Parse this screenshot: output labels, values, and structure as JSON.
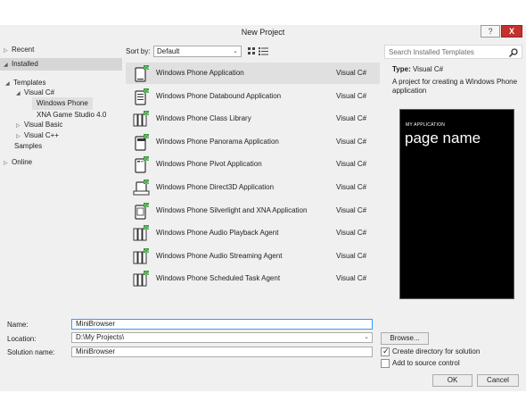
{
  "window": {
    "title": "New Project",
    "help_label": "?",
    "close_label": "X"
  },
  "tree": {
    "recent": "Recent",
    "installed": "Installed",
    "templates": "Templates",
    "visual_csharp": "Visual C#",
    "windows_phone": "Windows Phone",
    "xna": "XNA Game Studio 4.0",
    "visual_basic": "Visual Basic",
    "visual_cpp": "Visual C++",
    "samples": "Samples",
    "online": "Online"
  },
  "sort": {
    "label": "Sort by:",
    "value": "Default"
  },
  "templates": [
    {
      "name": "Windows Phone Application",
      "lang": "Visual C#",
      "selected": true
    },
    {
      "name": "Windows Phone Databound Application",
      "lang": "Visual C#"
    },
    {
      "name": "Windows Phone Class Library",
      "lang": "Visual C#"
    },
    {
      "name": "Windows Phone Panorama Application",
      "lang": "Visual C#"
    },
    {
      "name": "Windows Phone Pivot Application",
      "lang": "Visual C#"
    },
    {
      "name": "Windows Phone Direct3D Application",
      "lang": "Visual C#"
    },
    {
      "name": "Windows Phone Silverlight and XNA Application",
      "lang": "Visual C#"
    },
    {
      "name": "Windows Phone Audio Playback Agent",
      "lang": "Visual C#"
    },
    {
      "name": "Windows Phone Audio Streaming Agent",
      "lang": "Visual C#"
    },
    {
      "name": "Windows Phone Scheduled Task Agent",
      "lang": "Visual C#"
    }
  ],
  "details": {
    "search_placeholder": "Search Installed Templates",
    "type_label": "Type:",
    "type_value": "Visual C#",
    "description": "A project for creating a Windows Phone application",
    "preview_app": "MY APPLICATION",
    "preview_page": "page name"
  },
  "form": {
    "name_label": "Name:",
    "name_value": "MiniBrowser",
    "location_label": "Location:",
    "location_value": "D:\\My Projects\\",
    "solution_label": "Solution name:",
    "solution_value": "MiniBrowser",
    "browse": "Browse...",
    "create_dir": "Create directory for solution",
    "create_dir_checked": true,
    "add_source": "Add to source control",
    "add_source_checked": false,
    "ok": "OK",
    "cancel": "Cancel"
  },
  "colors": {
    "accent_green": "#3c9a3c",
    "close_red": "#c4302b",
    "selection": "#e0e0e0"
  }
}
